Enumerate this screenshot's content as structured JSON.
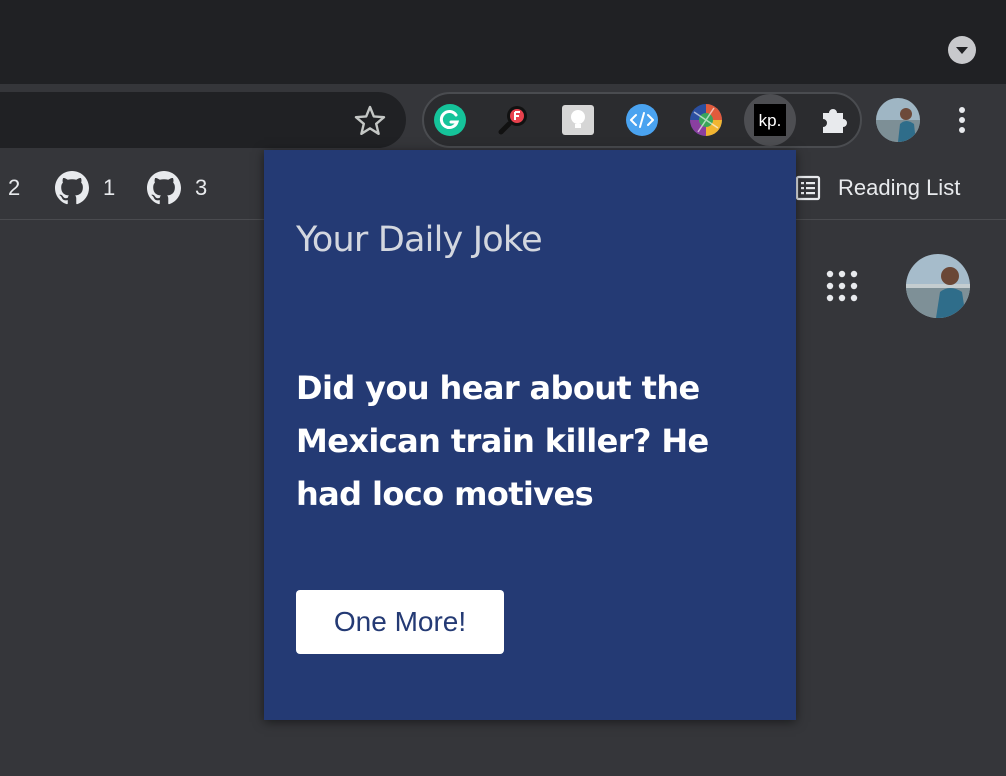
{
  "bookmarks": {
    "items": [
      {
        "label": "2",
        "icon": "github-icon"
      },
      {
        "label": "1",
        "icon": "github-icon"
      },
      {
        "label": "3",
        "icon": "github-icon"
      }
    ],
    "reading_list": "Reading List"
  },
  "extensions": [
    {
      "name": "grammarly-icon",
      "color": "#15c39a"
    },
    {
      "name": "search-magnifier-icon",
      "color": "#e8414d"
    },
    {
      "name": "lightbulb-icon",
      "color": "#d6d6d6"
    },
    {
      "name": "code-brackets-icon",
      "color": "#4aa3f0"
    },
    {
      "name": "colorful-ball-icon",
      "color": "#e05b3c"
    },
    {
      "name": "kp-extension-icon",
      "label": "kp.",
      "color": "#000000"
    },
    {
      "name": "puzzle-icon",
      "color": "#e8eaed"
    }
  ],
  "popup": {
    "title": "Your Daily Joke",
    "joke": "Did you hear about the Mexican train killer? He had loco motives",
    "button_label": "One More!",
    "background": "#243a74"
  }
}
